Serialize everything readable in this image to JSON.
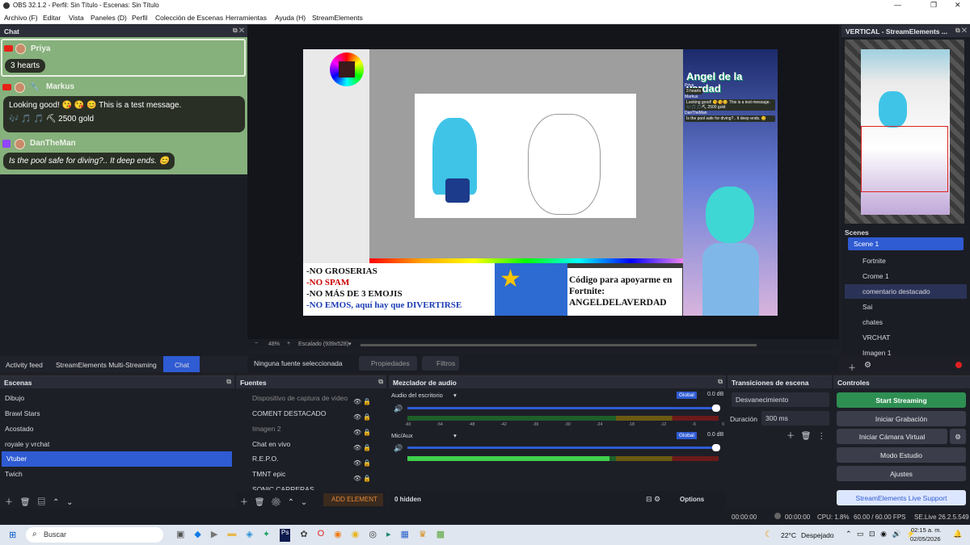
{
  "window": {
    "title": "OBS 32.1.2 - Perfil: Sin Título - Escenas: Sin Título",
    "min": "—",
    "max": "❐",
    "close": "✕"
  },
  "menu": [
    "Archivo (F)",
    "Editar",
    "Vista",
    "Paneles (D)",
    "Perfil",
    "Colección de Escenas",
    "Herramientas",
    "Ayuda (H)",
    "StreamElements"
  ],
  "chat": {
    "title": "Chat",
    "messages": [
      {
        "user": "Priya",
        "text": "3 hearts",
        "platform": "youtube"
      },
      {
        "user": "Markus",
        "text": "Looking good! 😘 😘 😊 This is a test message.",
        "extra": "🎶 🎵 🎵 ⛏ 2500 gold",
        "platform": "youtube"
      },
      {
        "user": "DanTheMan",
        "text": "Is the pool safe for diving?.. It deep ends. 😊",
        "platform": "twitch"
      }
    ],
    "tabs": [
      "Activity feed",
      "StreamElements Multi-Streaming",
      "Chat"
    ]
  },
  "preview": {
    "zoom": "48%",
    "scale": "Escalado (939x528)",
    "overlay_title": "Angel de la verdad",
    "rules": [
      "-NO GROSERIAS",
      "-NO SPAM",
      "-NO MÁS DE 3 EMOJIS",
      "-NO EMOS, aquí hay que DIVERTIRSE"
    ],
    "code": "Código para apoyarme en Fortnite: ANGELDELAVERDAD",
    "mini_chat": [
      {
        "user": "Priya",
        "text": "3 hearts"
      },
      {
        "user": "Markus",
        "text": "Looking good! 😘😘😊 This is a test message. 🎶🎵🎵⛏ 2500 gold"
      },
      {
        "user": "DanTheMan",
        "text": "Is the pool safe for diving?.. It deep ends. 😊"
      }
    ]
  },
  "source_bar": {
    "none": "Ninguna fuente seleccionada",
    "props": "Propiedades",
    "filters": "Filtros"
  },
  "vertical": {
    "title": "VERTICAL - StreamElements ...",
    "scenes_label": "Scenes",
    "scene": "Scene 1",
    "sources": [
      "Fortnite",
      "Crome 1",
      "comentario destacado",
      "Sai",
      "chates",
      "VRCHAT",
      "Imagen 1"
    ]
  },
  "scenes": {
    "title": "Escenas",
    "items": [
      "Dibujo",
      "Brawl Stars",
      "Acostado",
      "royale y vrchat",
      "Vtuber",
      "Twich"
    ],
    "selected": 4
  },
  "sources": {
    "title": "Fuentes",
    "items": [
      "Dispositivo de captura de video",
      "COMENT DESTACADO",
      "Imagen 2",
      "Chat en vivo",
      "R.E.P.O.",
      "TMNT epic",
      "SONIC CARRERAS"
    ],
    "add": "ADD ELEMENT"
  },
  "mixer": {
    "title": "Mezclador de audio",
    "channels": [
      {
        "name": "Audio del escritorio",
        "db": "0.0 dB",
        "global": "Global"
      },
      {
        "name": "Mic/Aux",
        "db": "0.0 dB",
        "global": "Global"
      }
    ],
    "ticks": [
      "-60",
      "-54",
      "-48",
      "-42",
      "-36",
      "-30",
      "-24",
      "-18",
      "-12",
      "-6",
      "0"
    ],
    "hidden": "0 hidden",
    "options": "Options"
  },
  "transitions": {
    "title": "Transiciones de escena",
    "type": "Desvanecimiento",
    "duration_label": "Duración",
    "duration": "300 ms"
  },
  "controls": {
    "title": "Controles",
    "start": "Start Streaming",
    "record": "Iniciar Grabación",
    "vcam": "Iniciar Cámara Virtual",
    "studio": "Modo Estudio",
    "settings": "Ajustes",
    "support": "StreamElements Live Support"
  },
  "status": {
    "time1": "00:00:00",
    "time2": "00:00:00",
    "cpu": "CPU: 1.8%",
    "fps": "60.00 / 60.00 FPS",
    "se": "SE.Live 26.2.5.549"
  },
  "taskbar": {
    "search": "Buscar",
    "temp": "22°C",
    "weather": "Despejado",
    "time": "02:15 a. m.",
    "date": "02/05/2026"
  }
}
